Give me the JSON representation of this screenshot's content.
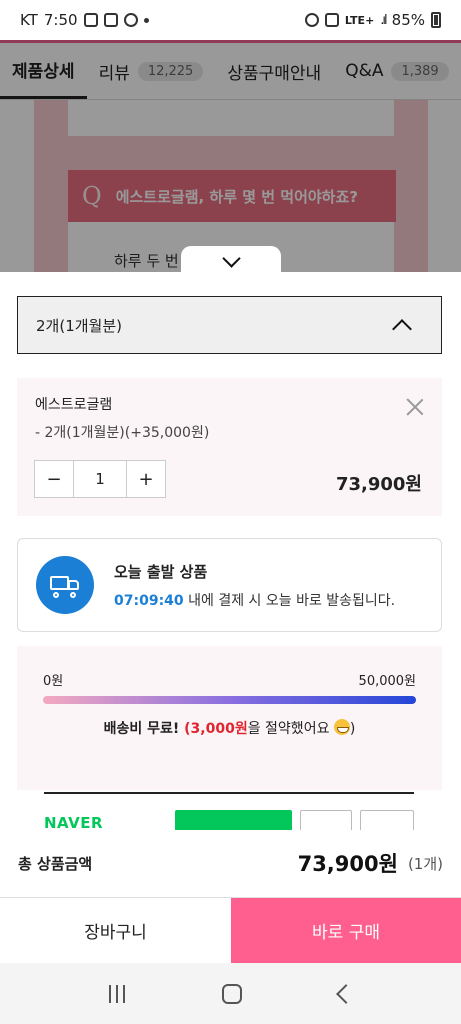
{
  "status_bar": {
    "carrier": "KT",
    "time": "7:50",
    "network": "LTE+",
    "battery": "85%"
  },
  "tabs": [
    {
      "label": "제품상세",
      "count": ""
    },
    {
      "label": "리뷰",
      "count": "12,225"
    },
    {
      "label": "상품구매안내",
      "count": ""
    },
    {
      "label": "Q&A",
      "count": "1,389"
    }
  ],
  "background": {
    "question_mark": "Q",
    "question": "에스트로글램, 하루 몇 번 먹어야하죠?",
    "answer": "하루 두 번"
  },
  "sheet": {
    "selected_option": "2개(1개월분)",
    "option": {
      "product_name": "에스트로글램",
      "option_detail": "- 2개(1개월분)(+35,000원)",
      "minus": "−",
      "quantity": "1",
      "plus": "+",
      "price": "73,900원"
    },
    "shipping": {
      "title": "오늘 출발 상품",
      "countdown": "07:09:40",
      "desc": " 내에 결제 시 오늘 바로 발송됩니다."
    },
    "free_shipping": {
      "min_label": "0원",
      "max_label": "50,000원",
      "msg_prefix": "배송비 무료! ",
      "msg_amount": "(3,000원",
      "msg_suffix": "을 절약했어요 ",
      "msg_end": ")"
    },
    "naver_pay": {
      "label": "NAVER"
    }
  },
  "total": {
    "label": "총 상품금액",
    "amount": "73,900원",
    "quantity": "(1개)"
  },
  "actions": {
    "cart": "장바구니",
    "buy": "바로 구매"
  }
}
